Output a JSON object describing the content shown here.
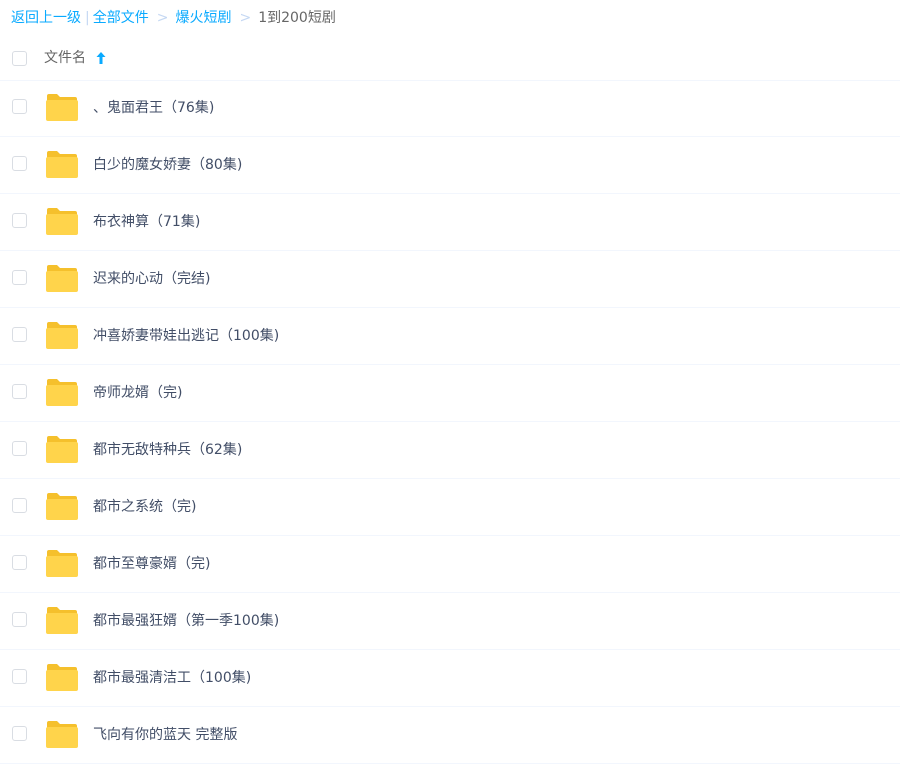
{
  "breadcrumb": {
    "back": "返回上一级",
    "all_files": "全部文件",
    "parent": "爆火短剧",
    "current": "1到200短剧",
    "pipe": "|",
    "sep": ">"
  },
  "header": {
    "column_name": "文件名",
    "sort_direction": "ascending"
  },
  "files": [
    {
      "name": "、鬼面君王（76集)",
      "type": "folder"
    },
    {
      "name": "白少的魔女娇妻（80集)",
      "type": "folder"
    },
    {
      "name": "布衣神算（71集)",
      "type": "folder"
    },
    {
      "name": "迟来的心动（完结)",
      "type": "folder"
    },
    {
      "name": "冲喜娇妻带娃出逃记（100集)",
      "type": "folder"
    },
    {
      "name": "帝师龙婿（完)",
      "type": "folder"
    },
    {
      "name": "都市无敌特种兵（62集)",
      "type": "folder"
    },
    {
      "name": "都市之系统（完)",
      "type": "folder"
    },
    {
      "name": "都市至尊豪婿（完)",
      "type": "folder"
    },
    {
      "name": "都市最强狂婿（第一季100集)",
      "type": "folder"
    },
    {
      "name": "都市最强清洁工（100集)",
      "type": "folder"
    },
    {
      "name": "飞向有你的蓝天 完整版",
      "type": "folder"
    }
  ],
  "colors": {
    "link": "#09aaff",
    "text": "#424e67",
    "folder": "#ffd44b",
    "folder_tab": "#f5c02c",
    "divider": "#f2f6fd"
  }
}
